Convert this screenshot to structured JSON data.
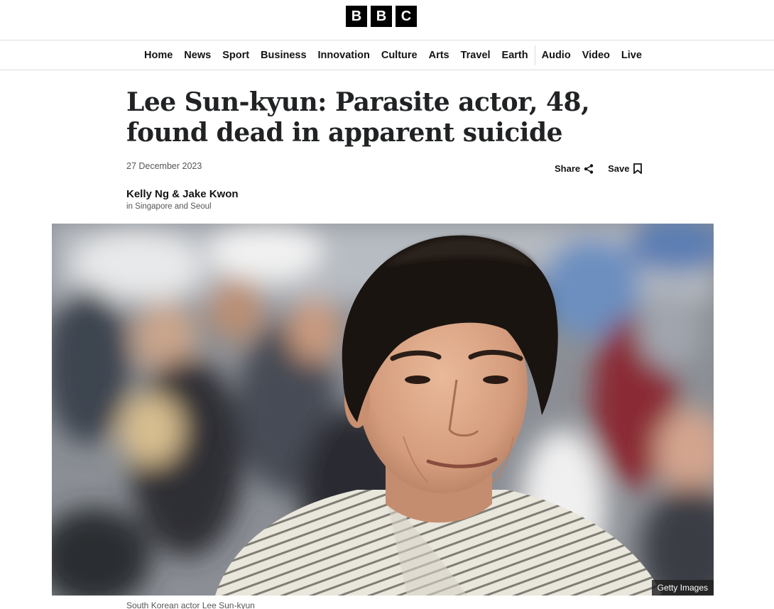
{
  "brand": {
    "logo_letters": [
      "B",
      "B",
      "C"
    ]
  },
  "nav": {
    "items": [
      "Home",
      "News",
      "Sport",
      "Business",
      "Innovation",
      "Culture",
      "Arts",
      "Travel",
      "Earth",
      "Audio",
      "Video",
      "Live"
    ]
  },
  "article": {
    "headline": "Lee Sun-kyun: Parasite actor, 48, found dead in apparent suicide",
    "date": "27 December 2023",
    "author": "Kelly Ng & Jake Kwon",
    "location": "in Singapore and Seoul",
    "share_label": "Share",
    "save_label": "Save",
    "image_credit": "Getty Images",
    "image_caption": "South Korean actor Lee Sun-kyun"
  },
  "icons": {
    "share": "share-icon",
    "save": "bookmark-icon"
  }
}
